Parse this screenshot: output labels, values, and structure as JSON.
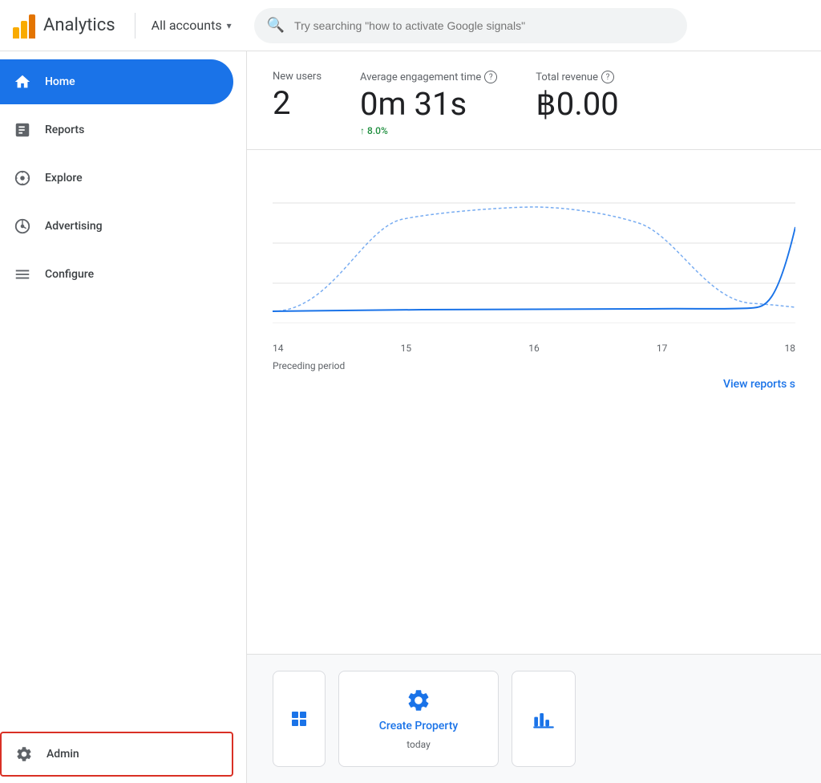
{
  "header": {
    "app_name": "Analytics",
    "account_label": "All accounts",
    "search_placeholder": "Try searching \"how to activate Google signals\""
  },
  "sidebar": {
    "items": [
      {
        "id": "home",
        "label": "Home",
        "active": true
      },
      {
        "id": "reports",
        "label": "Reports",
        "active": false
      },
      {
        "id": "explore",
        "label": "Explore",
        "active": false
      },
      {
        "id": "advertising",
        "label": "Advertising",
        "active": false
      },
      {
        "id": "configure",
        "label": "Configure",
        "active": false
      }
    ],
    "admin_label": "Admin"
  },
  "stats": {
    "new_users_label": "New users",
    "new_users_value": "2",
    "engagement_label": "Average engagement time",
    "engagement_value": "0m 31s",
    "engagement_change": "↑ 8.0%",
    "revenue_label": "Total revenue",
    "revenue_value": "฿0.00"
  },
  "chart": {
    "x_labels": [
      "14",
      "15",
      "16",
      "17",
      "18"
    ],
    "preceding_label": "Preceding period",
    "view_reports_label": "View reports s"
  },
  "bottom_cards": [
    {
      "icon": "gear",
      "title": "Create Property",
      "subtitle": "today"
    },
    {
      "icon": "chart",
      "title": "",
      "subtitle": ""
    }
  ]
}
